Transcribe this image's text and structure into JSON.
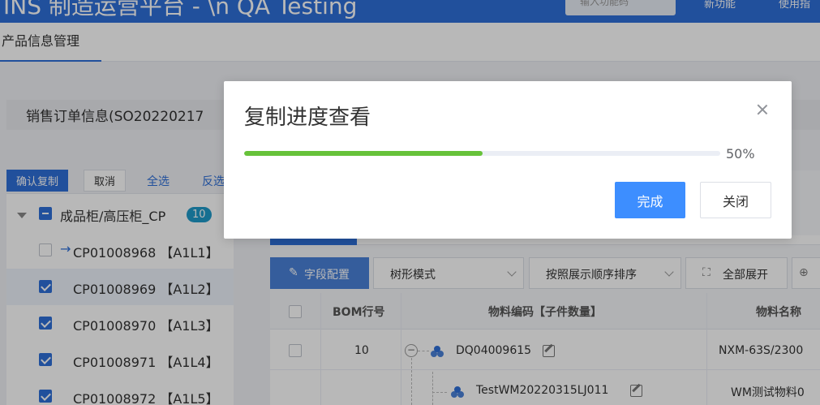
{
  "header": {
    "app_title": "INS 制造运营平台 - \\n QA Testing",
    "search_placeholder": "输入功能码",
    "links": [
      "新功能",
      "使用指"
    ]
  },
  "tabs": {
    "active_label": "产品信息管理"
  },
  "sales_order": {
    "title": "销售订单信息(SO20220217"
  },
  "left_actions": {
    "confirm_label": "确认复制",
    "cancel_label": "取消",
    "select_all_label": "全选",
    "invert_label": "反选"
  },
  "tree": {
    "root": {
      "label": "成品柜/高压柜_CP",
      "count": "10"
    },
    "items": [
      {
        "label": "CP01008968 【A1L1】",
        "checked": false,
        "arrow": "→"
      },
      {
        "label": "CP01008969 【A1L2】",
        "checked": true
      },
      {
        "label": "CP01008970 【A1L3】",
        "checked": true
      },
      {
        "label": "CP01008971 【A1L4】",
        "checked": true
      },
      {
        "label": "CP01008972 【A1L5】",
        "checked": true
      }
    ]
  },
  "toolbar": {
    "field_config_label": "字段配置",
    "tree_mode_label": "树形模式",
    "sort_label": "按照展示顺序排序",
    "expand_all_label": "全部展开"
  },
  "grid": {
    "headers": [
      "BOM行号",
      "物料编码【子件数量】",
      "物料名称"
    ],
    "rows": [
      {
        "bom": "10",
        "code": "DQ04009615",
        "name": "NXM-63S/2300"
      },
      {
        "bom": "",
        "code": "TestWM20220315LJ011",
        "name": "WM测试物料0"
      }
    ],
    "expander": "−"
  },
  "dialog": {
    "title": "复制进度查看",
    "progress_percent": 50,
    "progress_text": "50%",
    "done_label": "完成",
    "close_label": "关闭"
  },
  "colors": {
    "brand": "#2f6fd8",
    "progress": "#67c23a",
    "primary_button": "#3d8eff"
  }
}
